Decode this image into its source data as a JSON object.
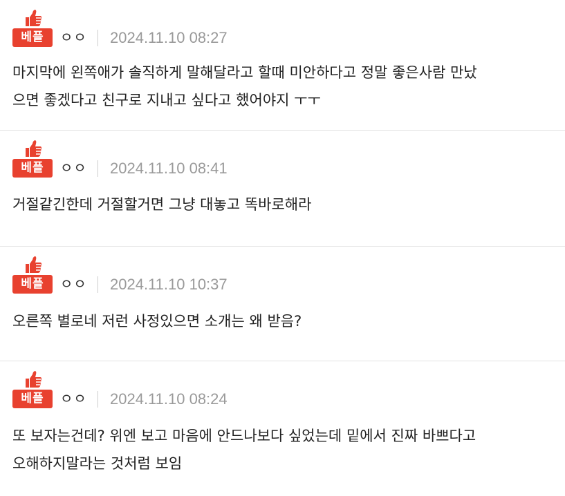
{
  "comments": [
    {
      "badge": "베플",
      "author": "ㅇㅇ",
      "timestamp": "2024.11.10 08:27",
      "lines": [
        "마지막에 왼쪽애가 솔직하게 말해달라고 할때 미안하다고 정말 좋은사람 만났",
        "으면 좋겠다고 친구로 지내고 싶다고 했어야지 ㅜㅜ"
      ]
    },
    {
      "badge": "베플",
      "author": "ㅇㅇ",
      "timestamp": "2024.11.10 08:41",
      "lines": [
        "거절같긴한데 거절할거면 그냥 대놓고 똑바로해라"
      ]
    },
    {
      "badge": "베플",
      "author": "ㅇㅇ",
      "timestamp": "2024.11.10 10:37",
      "lines": [
        "오른쪽 별로네 저런 사정있으면 소개는 왜 받음?"
      ]
    },
    {
      "badge": "베플",
      "author": "ㅇㅇ",
      "timestamp": "2024.11.10 08:24",
      "lines": [
        "또 보자는건데? 위엔 보고 마음에 안드나보다 싶었는데 밑에서 진짜 바쁘다고",
        "오해하지말라는 것처럼 보임"
      ]
    }
  ],
  "colors": {
    "badge_bg": "#e8412f",
    "timestamp": "#9a9a9a",
    "divider": "#e2e2e2"
  },
  "icons": {
    "badge_icon": "thumbs-up-icon"
  }
}
